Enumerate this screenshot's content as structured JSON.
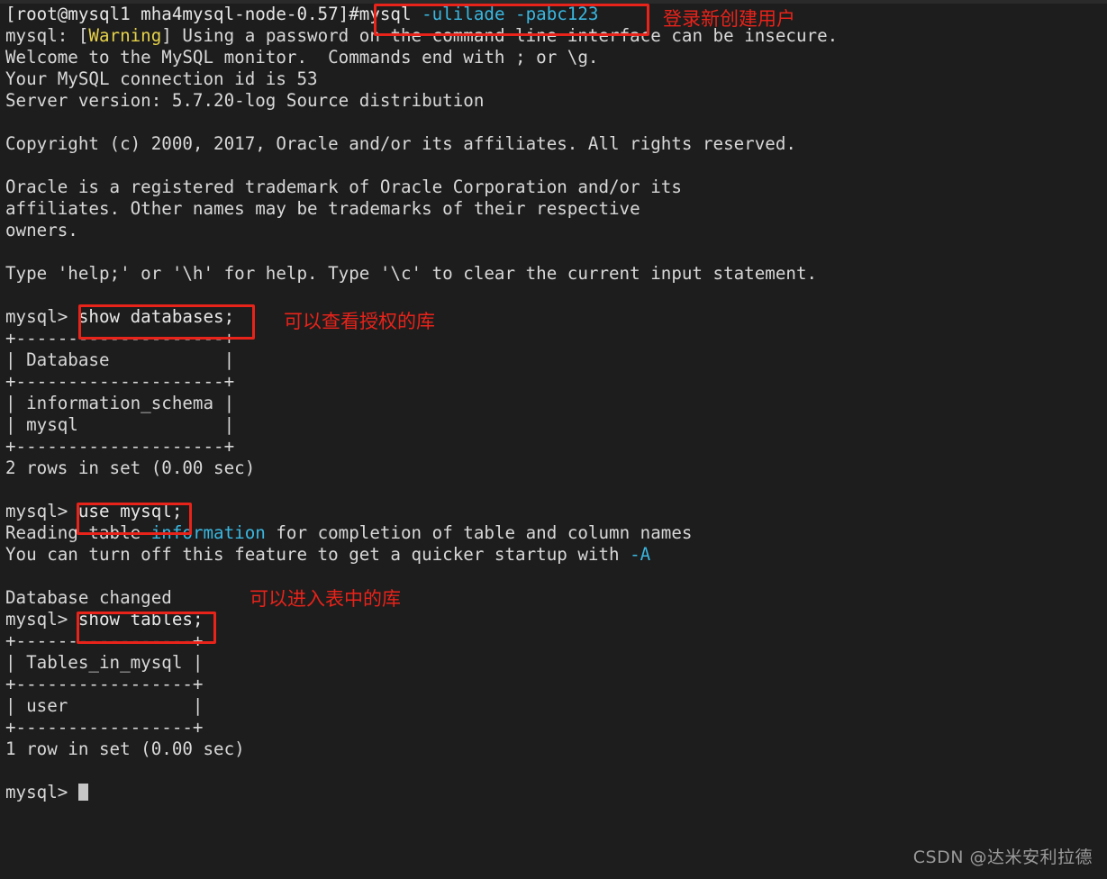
{
  "terminal": {
    "background_color": "#1d1d1d",
    "foreground_color": "#d8d8d8",
    "cyan_color": "#3ab7e0",
    "yellow_color": "#e6d24a",
    "annotation_color": "#e8231a",
    "lines": {
      "l01_prompt": "[root@mysql1 mha4mysql-node-0.57]#",
      "l01_cmd_a": "mysql",
      "l01_cmd_b": " -ulilade -pabc123",
      "l02_a": "mysql: [",
      "l02_warning": "Warning",
      "l02_b": "] Using a password on the command line interface can be insecure.",
      "l03": "Welcome to the MySQL monitor.  Commands end with ; or \\g.",
      "l04": "Your MySQL connection id is 53",
      "l05": "Server version: 5.7.20-log Source distribution",
      "l07": "Copyright (c) 2000, 2017, Oracle and/or its affiliates. All rights reserved.",
      "l09": "Oracle is a registered trademark of Oracle Corporation and/or its",
      "l10": "affiliates. Other names may be trademarks of their respective",
      "l11": "owners.",
      "l13": "Type 'help;' or '\\h' for help. Type '\\c' to clear the current input statement.",
      "l15_prompt": "mysql> ",
      "l15_cmd": "show databases;",
      "l16": "+--------------------+",
      "l17": "| Database           |",
      "l18": "+--------------------+",
      "l19": "| information_schema |",
      "l20": "| mysql              |",
      "l21": "+--------------------+",
      "l22": "2 rows in set (0.00 sec)",
      "l24_prompt": "mysql> ",
      "l24_cmd": "use mysql;",
      "l25_a": "Reading table ",
      "l25_info": "information",
      "l25_b": " for completion of table and column names",
      "l26_a": "You can turn off this feature to get a quicker startup with ",
      "l26_flag": "-A",
      "l28": "Database changed",
      "l29_prompt": "mysql> ",
      "l29_cmd": "show tables;",
      "l30": "+-----------------+",
      "l31": "| Tables_in_mysql |",
      "l32": "+-----------------+",
      "l33": "| user            |",
      "l34": "+-----------------+",
      "l35": "1 row in set (0.00 sec)",
      "l37_prompt": "mysql> "
    }
  },
  "annotations": {
    "login_new_user": "登录新创建用户",
    "view_granted_dbs": "可以查看授权的库",
    "enter_db_tables": "可以进入表中的库"
  },
  "watermark": {
    "text": "CSDN @达米安利拉德"
  }
}
